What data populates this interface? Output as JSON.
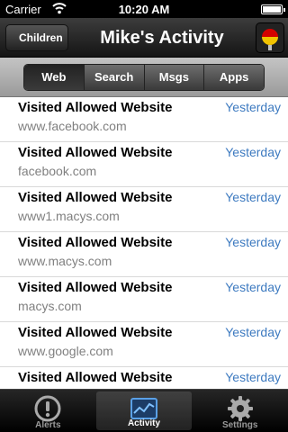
{
  "status_bar": {
    "carrier": "Carrier",
    "time": "10:20 AM"
  },
  "nav_bar": {
    "back_label": "Children",
    "title": "Mike's Activity",
    "flag_icon": "flag-icon"
  },
  "segments": [
    {
      "label": "Web",
      "selected": true
    },
    {
      "label": "Search",
      "selected": false
    },
    {
      "label": "Msgs",
      "selected": false
    },
    {
      "label": "Apps",
      "selected": false
    }
  ],
  "activity": [
    {
      "title": "Visited Allowed Website",
      "url": "www.facebook.com",
      "time": "Yesterday"
    },
    {
      "title": "Visited Allowed Website",
      "url": "facebook.com",
      "time": "Yesterday"
    },
    {
      "title": "Visited Allowed Website",
      "url": "www1.macys.com",
      "time": "Yesterday"
    },
    {
      "title": "Visited Allowed Website",
      "url": "www.macys.com",
      "time": "Yesterday"
    },
    {
      "title": "Visited Allowed Website",
      "url": "macys.com",
      "time": "Yesterday"
    },
    {
      "title": "Visited Allowed Website",
      "url": "www.google.com",
      "time": "Yesterday"
    },
    {
      "title": "Visited Allowed Website",
      "url": "",
      "time": "Yesterday"
    }
  ],
  "tabs": [
    {
      "label": "Alerts",
      "icon": "alert-icon",
      "selected": false
    },
    {
      "label": "Activity",
      "icon": "activity-chart-icon",
      "selected": true
    },
    {
      "label": "Settings",
      "icon": "gear-icon",
      "selected": false
    }
  ],
  "colors": {
    "accent_link": "#3d7ac0",
    "flag_red": "#d40000",
    "flag_yellow": "#f2c300"
  }
}
